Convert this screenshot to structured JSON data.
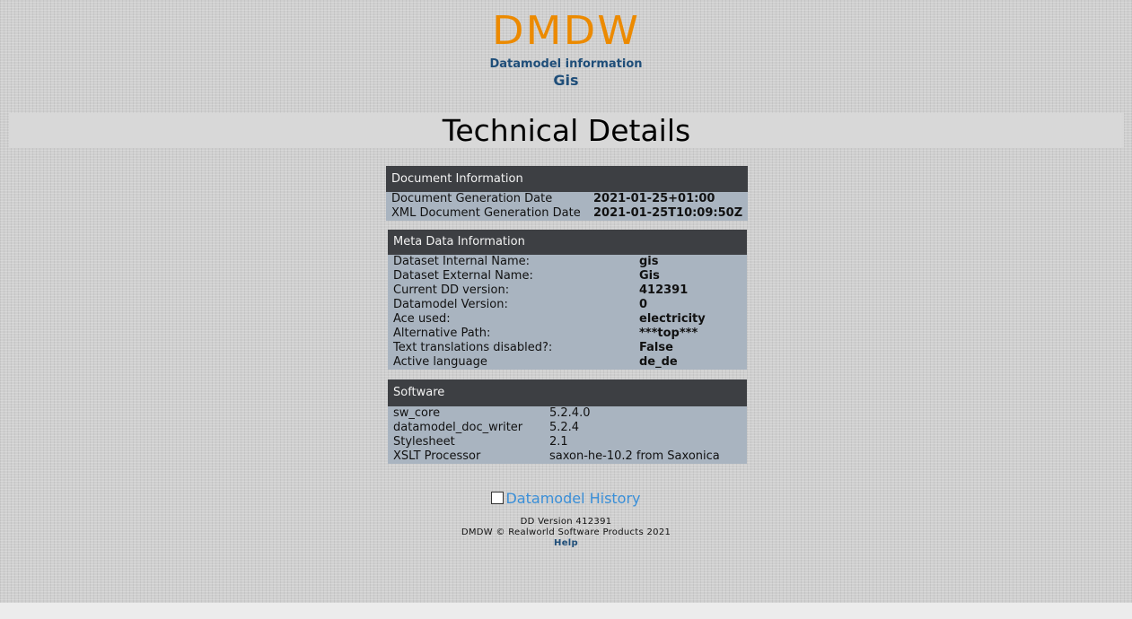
{
  "header": {
    "logo": "DMDW",
    "subtitle": "Datamodel information",
    "model_name": "Gis"
  },
  "page_title": "Technical Details",
  "document_information": {
    "title": "Document Information",
    "rows": [
      {
        "label": "Document Generation Date",
        "value": "2021-01-25+01:00"
      },
      {
        "label": "XML Document Generation Date",
        "value": "2021-01-25T10:09:50Z"
      }
    ]
  },
  "meta_data_information": {
    "title": "Meta Data Information",
    "rows": [
      {
        "label": "Dataset Internal Name:",
        "value": "gis"
      },
      {
        "label": "Dataset External Name:",
        "value": "Gis"
      },
      {
        "label": "Current DD version:",
        "value": "412391"
      },
      {
        "label": "Datamodel Version:",
        "value": "0"
      },
      {
        "label": "Ace used:",
        "value": "electricity"
      },
      {
        "label": "Alternative Path:",
        "value": "***top***"
      },
      {
        "label": "Text translations disabled?:",
        "value": "False"
      },
      {
        "label": "Active language",
        "value": "de_de"
      }
    ]
  },
  "software": {
    "title": "Software",
    "rows": [
      {
        "label": "sw_core",
        "value": "5.2.4.0"
      },
      {
        "label": "datamodel_doc_writer",
        "value": "5.2.4"
      },
      {
        "label": "Stylesheet",
        "value": "2.1"
      },
      {
        "label": "XSLT Processor",
        "value": "saxon-he-10.2 from Saxonica"
      }
    ]
  },
  "history_link": "Datamodel History",
  "footer": {
    "dd_version": "DD Version 412391",
    "copyright": "DMDW © Realworld Software Products 2021",
    "help": "Help"
  },
  "colors": {
    "logo": "#ec8a00",
    "header_text": "#1f4e79",
    "panel_header_bg": "#3d3f43",
    "panel_body_bg": "#a9b4c0",
    "link": "#3a8fd8"
  }
}
